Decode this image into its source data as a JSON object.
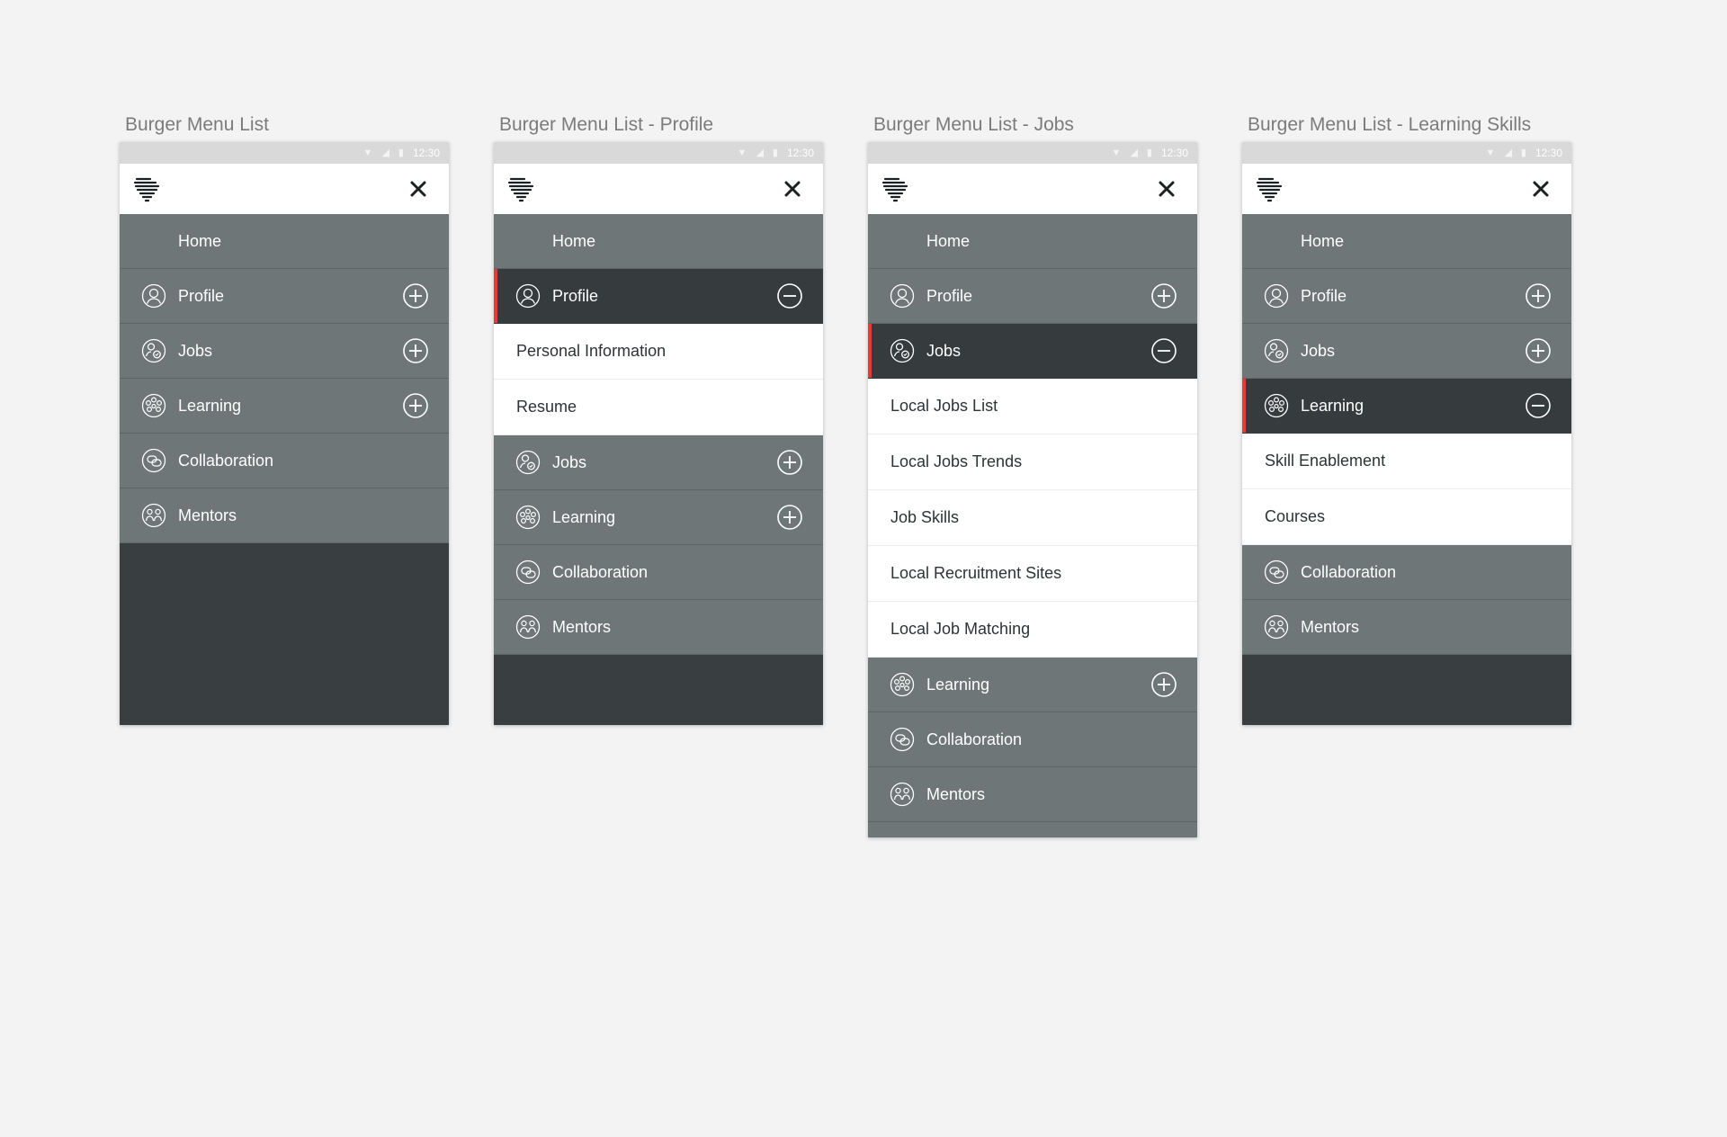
{
  "status": {
    "time": "12:30"
  },
  "labels": {
    "home": "Home",
    "profile": "Profile",
    "jobs": "Jobs",
    "learning": "Learning",
    "collaboration": "Collaboration",
    "mentors": "Mentors"
  },
  "screens": [
    {
      "title": "Burger Menu List"
    },
    {
      "title": "Burger Menu List - Profile",
      "submenu": [
        "Personal Information",
        "Resume"
      ]
    },
    {
      "title": "Burger Menu List - Jobs",
      "submenu": [
        "Local Jobs List",
        "Local Jobs Trends",
        "Job Skills",
        "Local Recruitment Sites",
        "Local Job Matching"
      ]
    },
    {
      "title": "Burger Menu List - Learning Skills",
      "submenu": [
        "Skill Enablement",
        "Courses"
      ]
    }
  ],
  "colors": {
    "menu_bg": "#6f7677",
    "active_bg": "#363b3d",
    "accent": "#e03c3c",
    "panel_bg": "#393e40",
    "page_bg": "#f3f3f3"
  }
}
